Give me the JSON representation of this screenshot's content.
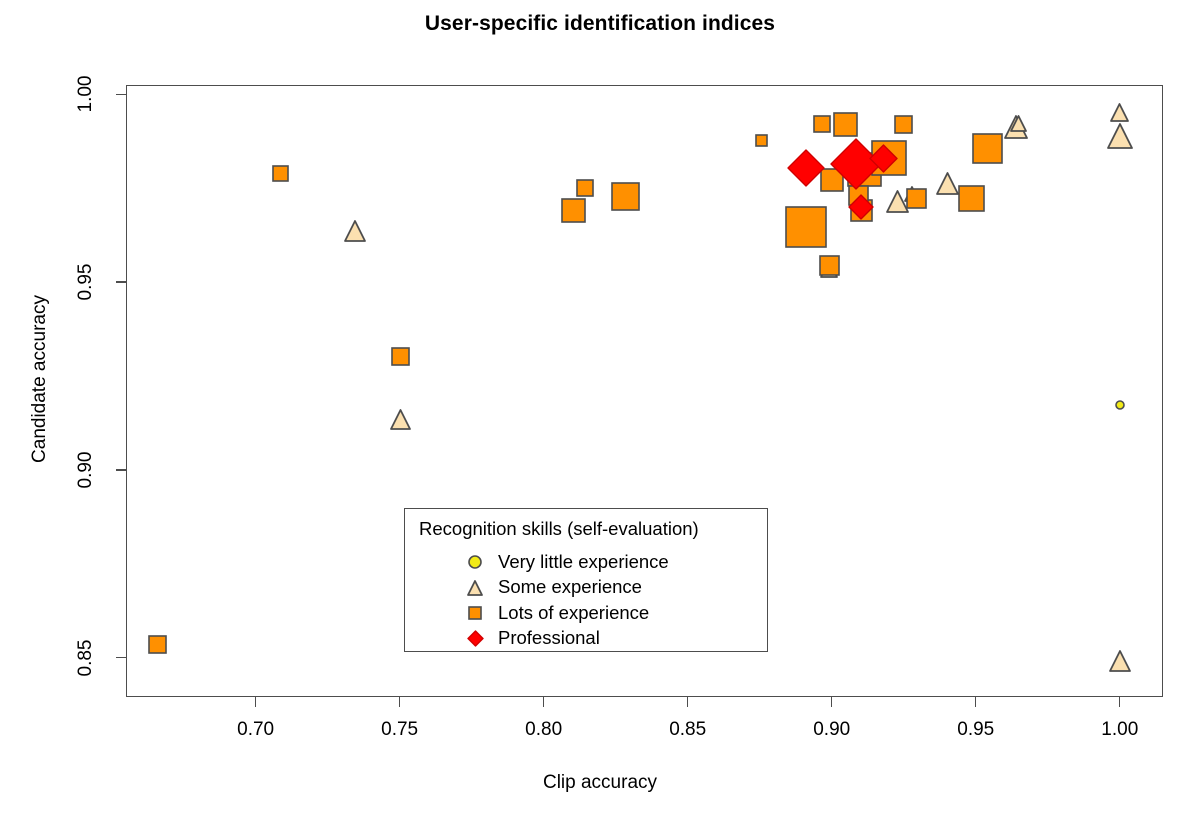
{
  "chart_data": {
    "type": "scatter",
    "title": "User-specific identification indices",
    "xlabel": "Clip accuracy",
    "ylabel": "Candidate accuracy",
    "xlim": [
      0.655,
      1.015
    ],
    "ylim": [
      0.8395,
      1.0025
    ],
    "xticks": [
      "0.70",
      "0.75",
      "0.80",
      "0.85",
      "0.90",
      "0.95",
      "1.00"
    ],
    "xtick_values": [
      0.7,
      0.75,
      0.8,
      0.85,
      0.9,
      0.95,
      1.0
    ],
    "yticks": [
      "0.85",
      "0.90",
      "0.95",
      "1.00"
    ],
    "ytick_values": [
      0.85,
      0.9,
      0.95,
      1.0
    ],
    "grid": false,
    "legend_position": "bottom-center",
    "legend_title": "Recognition skills (self-evaluation)",
    "series": [
      {
        "name": "Very little experience",
        "marker": "circle",
        "fill": "#F2EB18",
        "edge": "#4d4d4d",
        "points": [
          {
            "x": 1.0,
            "y": 0.9172,
            "size": 8
          }
        ]
      },
      {
        "name": "Some experience",
        "marker": "triangle",
        "fill": "#FBE0B0",
        "edge": "#4d4d4d",
        "points": [
          {
            "x": 0.7345,
            "y": 0.9635,
            "size": 20
          },
          {
            "x": 0.7502,
            "y": 0.9135,
            "size": 19
          },
          {
            "x": 0.9228,
            "y": 0.9715,
            "size": 21
          },
          {
            "x": 0.9279,
            "y": 0.9735,
            "size": 14
          },
          {
            "x": 0.9402,
            "y": 0.9762,
            "size": 21
          },
          {
            "x": 0.964,
            "y": 0.9912,
            "size": 22
          },
          {
            "x": 0.9648,
            "y": 0.9922,
            "size": 15
          },
          {
            "x": 0.8992,
            "y": 0.9534,
            "size": 16
          },
          {
            "x": 1.0,
            "y": 0.9952,
            "size": 17
          },
          {
            "x": 1.0,
            "y": 0.989,
            "size": 24
          },
          {
            "x": 1.0,
            "y": 0.849,
            "size": 20
          }
        ]
      },
      {
        "name": "Lots of experience",
        "marker": "square",
        "fill": "#FF9000",
        "edge": "#4d4d4d",
        "points": [
          {
            "x": 0.666,
            "y": 0.8535,
            "size": 17
          },
          {
            "x": 0.7085,
            "y": 0.979,
            "size": 15
          },
          {
            "x": 0.7502,
            "y": 0.9302,
            "size": 17
          },
          {
            "x": 0.8102,
            "y": 0.9692,
            "size": 23
          },
          {
            "x": 0.8142,
            "y": 0.9752,
            "size": 16
          },
          {
            "x": 0.8283,
            "y": 0.9728,
            "size": 27
          },
          {
            "x": 0.8755,
            "y": 0.9878,
            "size": 11
          },
          {
            "x": 0.8912,
            "y": 0.9648,
            "size": 40
          },
          {
            "x": 0.8992,
            "y": 0.9545,
            "size": 19
          },
          {
            "x": 0.8966,
            "y": 0.9922,
            "size": 16
          },
          {
            "x": 0.9049,
            "y": 0.992,
            "size": 23
          },
          {
            "x": 0.9,
            "y": 0.9772,
            "size": 22
          },
          {
            "x": 0.9115,
            "y": 0.98,
            "size": 33
          },
          {
            "x": 0.9102,
            "y": 0.969,
            "size": 21
          },
          {
            "x": 0.9092,
            "y": 0.9732,
            "size": 19
          },
          {
            "x": 0.92,
            "y": 0.983,
            "size": 34
          },
          {
            "x": 0.9248,
            "y": 0.992,
            "size": 17
          },
          {
            "x": 0.9295,
            "y": 0.9722,
            "size": 19
          },
          {
            "x": 0.954,
            "y": 0.9855,
            "size": 29
          },
          {
            "x": 0.9485,
            "y": 0.9722,
            "size": 25
          }
        ]
      },
      {
        "name": "Professional",
        "marker": "diamond",
        "fill": "#FF0000",
        "edge": "#D00000",
        "points": [
          {
            "x": 0.8912,
            "y": 0.9805,
            "size": 36
          },
          {
            "x": 0.9085,
            "y": 0.9815,
            "size": 50
          },
          {
            "x": 0.9178,
            "y": 0.983,
            "size": 27
          },
          {
            "x": 0.9102,
            "y": 0.97,
            "size": 24
          }
        ]
      }
    ]
  },
  "legend": {
    "title": "Recognition skills (self-evaluation)",
    "entries": [
      {
        "label": "Very little experience",
        "marker": "circle",
        "color": "#F2EB18"
      },
      {
        "label": "Some experience",
        "marker": "triangle",
        "color": "#FBE0B0"
      },
      {
        "label": "Lots of experience",
        "marker": "square",
        "color": "#FF9000"
      },
      {
        "label": "Professional",
        "marker": "diamond",
        "color": "#FF0000"
      }
    ]
  },
  "colors": {
    "very_little": "#F2EB18",
    "some": "#FBE0B0",
    "lots": "#FF9000",
    "professional": "#FF0000",
    "axis": "#4d4d4d",
    "text": "#000000"
  }
}
